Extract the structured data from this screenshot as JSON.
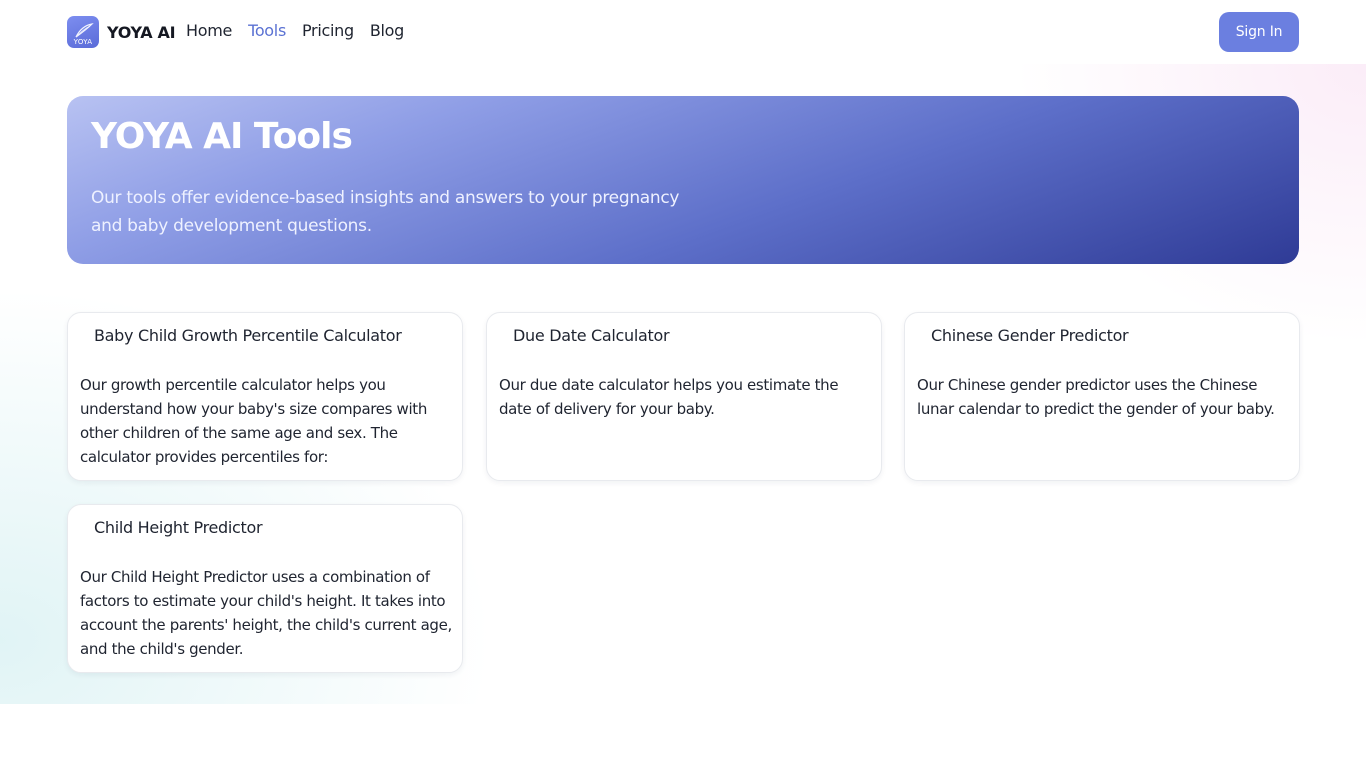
{
  "header": {
    "logo_text": "YOYA",
    "brand": "YOYA AI",
    "nav": [
      {
        "label": "Home",
        "active": false
      },
      {
        "label": "Tools",
        "active": true
      },
      {
        "label": "Pricing",
        "active": false
      },
      {
        "label": "Blog",
        "active": false
      }
    ],
    "signin_label": "Sign In",
    "accent_color": "#6b7fe0"
  },
  "hero": {
    "title": "YOYA AI Tools",
    "subtitle": "Our tools offer evidence-based insights and answers to your pregnancy and baby development questions."
  },
  "tools": [
    {
      "title": "Baby Child Growth Percentile Calculator",
      "description": "Our growth percentile calculator helps you understand how your baby's size compares with other children of the same age and sex. The calculator provides percentiles for:"
    },
    {
      "title": "Due Date Calculator",
      "description": "Our due date calculator helps you estimate the date of delivery for your baby."
    },
    {
      "title": "Chinese Gender Predictor",
      "description": "Our Chinese gender predictor uses the Chinese lunar calendar to predict the gender of your baby."
    },
    {
      "title": "Child Height Predictor",
      "description": "Our Child Height Predictor uses a combination of factors to estimate your child's height. It takes into account the parents' height, the child's current age, and the child's gender."
    }
  ]
}
